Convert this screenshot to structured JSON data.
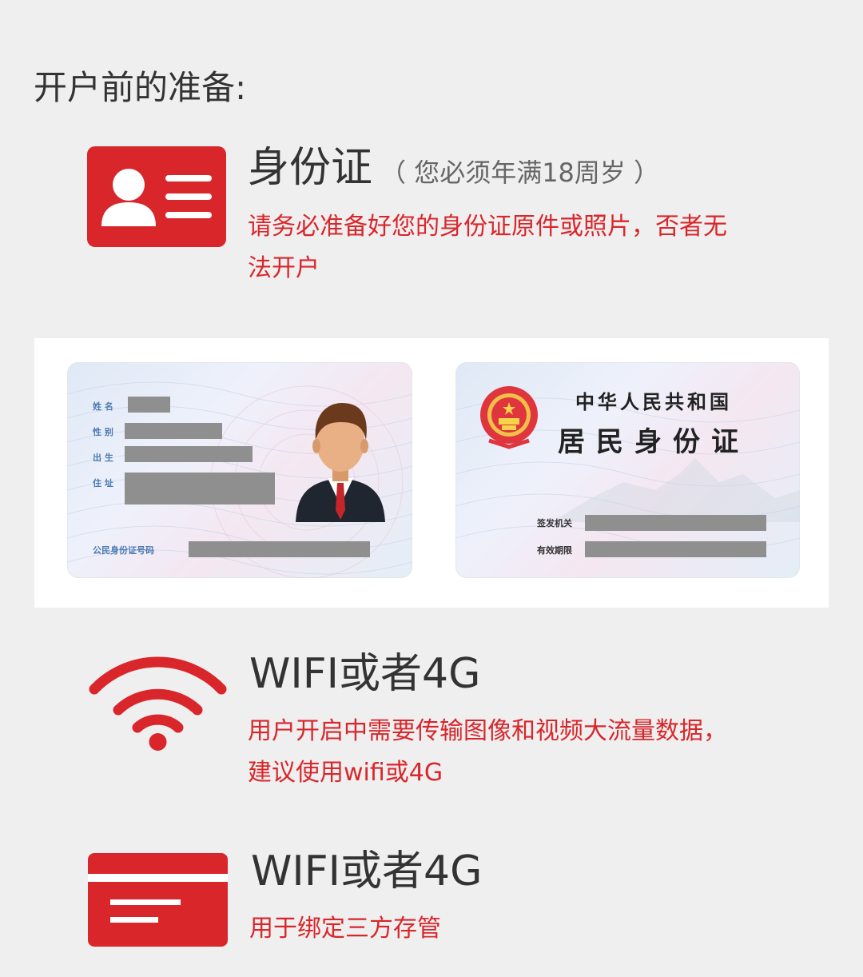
{
  "heading": "开户前的准备:",
  "colors": {
    "accent": "#d9262b",
    "text": "#333333",
    "background": "#efefef"
  },
  "items": [
    {
      "icon": "id-card-icon",
      "title": "身份证",
      "title_note": "（ 您必须年满18周岁 ）",
      "desc_line1": "请务必准备好您的身份证原件或照片，否者无",
      "desc_line2": "法开户"
    },
    {
      "icon": "wifi-icon",
      "title": "WIFI或者4G",
      "desc_line1": "用户开启中需要传输图像和视频大流量数据，",
      "desc_line2": "建议使用wifi或4G"
    },
    {
      "icon": "bank-card-icon",
      "title": "WIFI或者4G",
      "desc_line1": "用于绑定三方存管"
    }
  ],
  "id_front": {
    "name_label": "姓 名",
    "gender_label": "性 别",
    "birth_label": "出 生",
    "address_label": "住 址",
    "id_number_label": "公民身份证号码"
  },
  "id_back": {
    "title1": "中华人民共和国",
    "title2": "居民身份证",
    "authority_label": "签发机关",
    "validity_label": "有效期限"
  }
}
